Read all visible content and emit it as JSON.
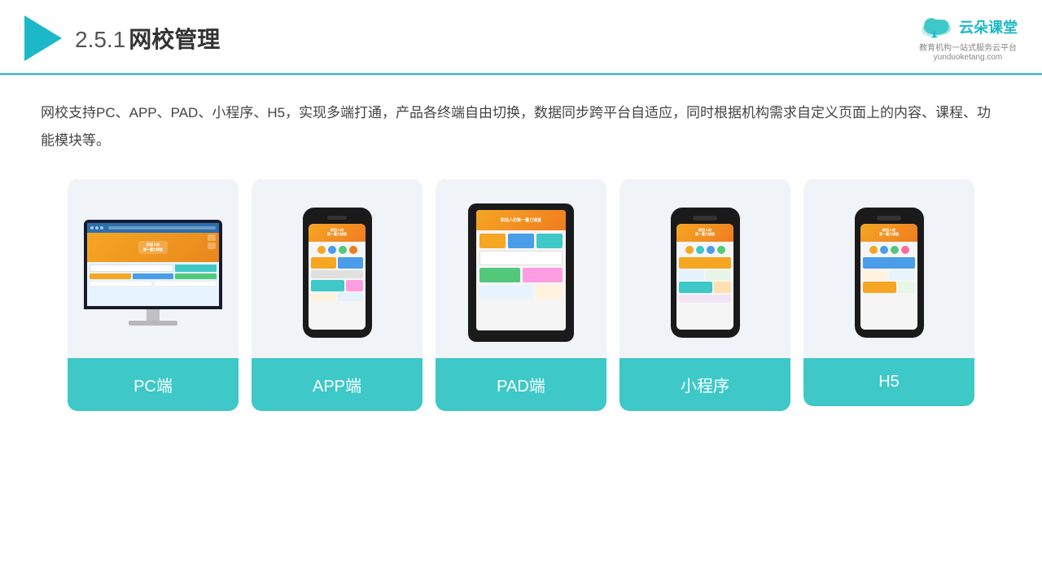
{
  "header": {
    "section_number": "2.5.1",
    "title": "网校管理",
    "brand_name": "云朵课堂",
    "brand_url": "yunduoketang.com",
    "brand_tagline": "教育机构一站\n式服务云平台"
  },
  "description": {
    "text": "网校支持PC、APP、PAD、小程序、H5，实现多端打通，产品各终端自由切换，数据同步跨平台自适应，同时根据机构需求自定义页面上的内容、课程、功能模块等。"
  },
  "cards": [
    {
      "id": "pc",
      "label": "PC端"
    },
    {
      "id": "app",
      "label": "APP端"
    },
    {
      "id": "pad",
      "label": "PAD端"
    },
    {
      "id": "miniprogram",
      "label": "小程序"
    },
    {
      "id": "h5",
      "label": "H5"
    }
  ],
  "colors": {
    "teal": "#3ec8c8",
    "accent": "#1cb8c8",
    "text_dark": "#333",
    "text_desc": "#444"
  }
}
